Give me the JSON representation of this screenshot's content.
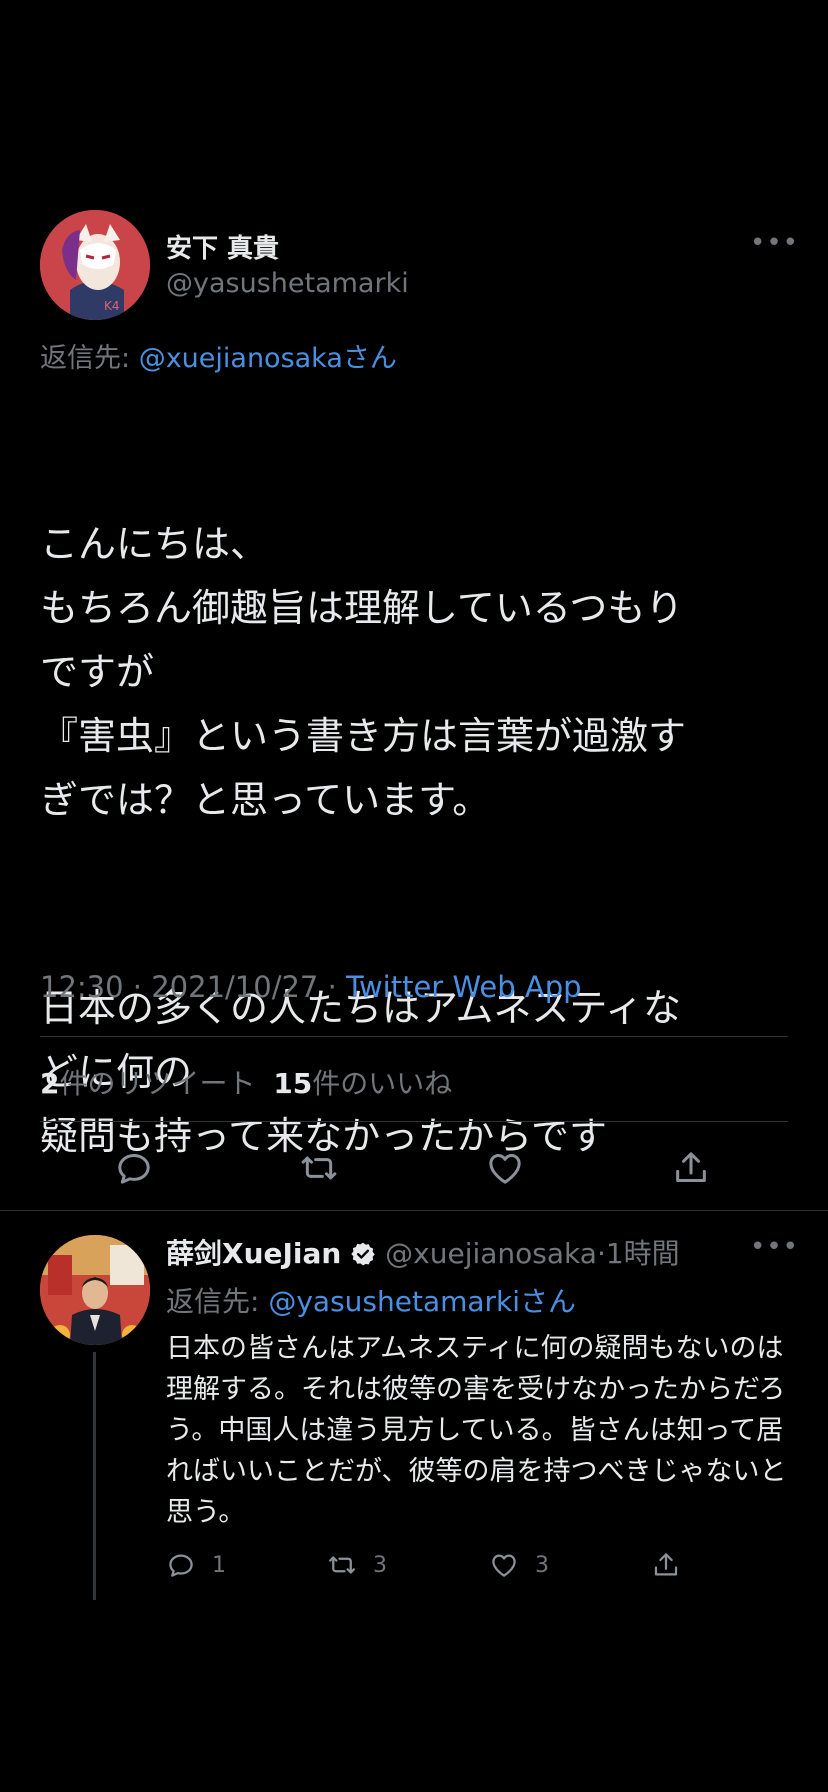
{
  "main_tweet": {
    "display_name": "安下 真貴",
    "handle": "@yasushetamarki",
    "reply_prefix": "返信先: ",
    "reply_to": "@xuejianosakaさん",
    "paragraphs": [
      "こんにちは、\nもちろん御趣旨は理解しているつもり\nですが\n『害虫』という書き方は言葉が過激す\nぎでは？と思っています。",
      "日本の多くの人たちはアムネスティな\nどに何の\n疑問も持って来なかったからです"
    ],
    "time": "12:30 · 2021/10/27 · ",
    "source": "Twitter Web App",
    "retweet_count": "2",
    "retweet_label": "件のリツイート",
    "like_count": "15",
    "like_label": "件のいいね",
    "more": "•••"
  },
  "reply_tweet": {
    "display_name": "薛剑XueJian",
    "handle": "@xuejianosaka",
    "time": "·1時間",
    "reply_prefix": "返信先: ",
    "reply_to": "@yasushetamarkiさん",
    "body": "日本の皆さんはアムネスティに何の疑問もないのは理解する。それは彼等の害を受けなかったからだろう。中国人は違う見方している。皆さんは知って居ればいいことだが、彼等の肩を持つべきじゃないと思う。",
    "reply_count": "1",
    "retweet_count": "3",
    "like_count": "3",
    "more": "•••"
  },
  "icons": [
    "reply-icon",
    "retweet-icon",
    "like-icon",
    "share-icon",
    "verified-icon",
    "more-icon"
  ],
  "colors": {
    "background": "#000000",
    "text": "#e7e9ea",
    "secondary": "#71767b",
    "link": "#4a90e2"
  }
}
